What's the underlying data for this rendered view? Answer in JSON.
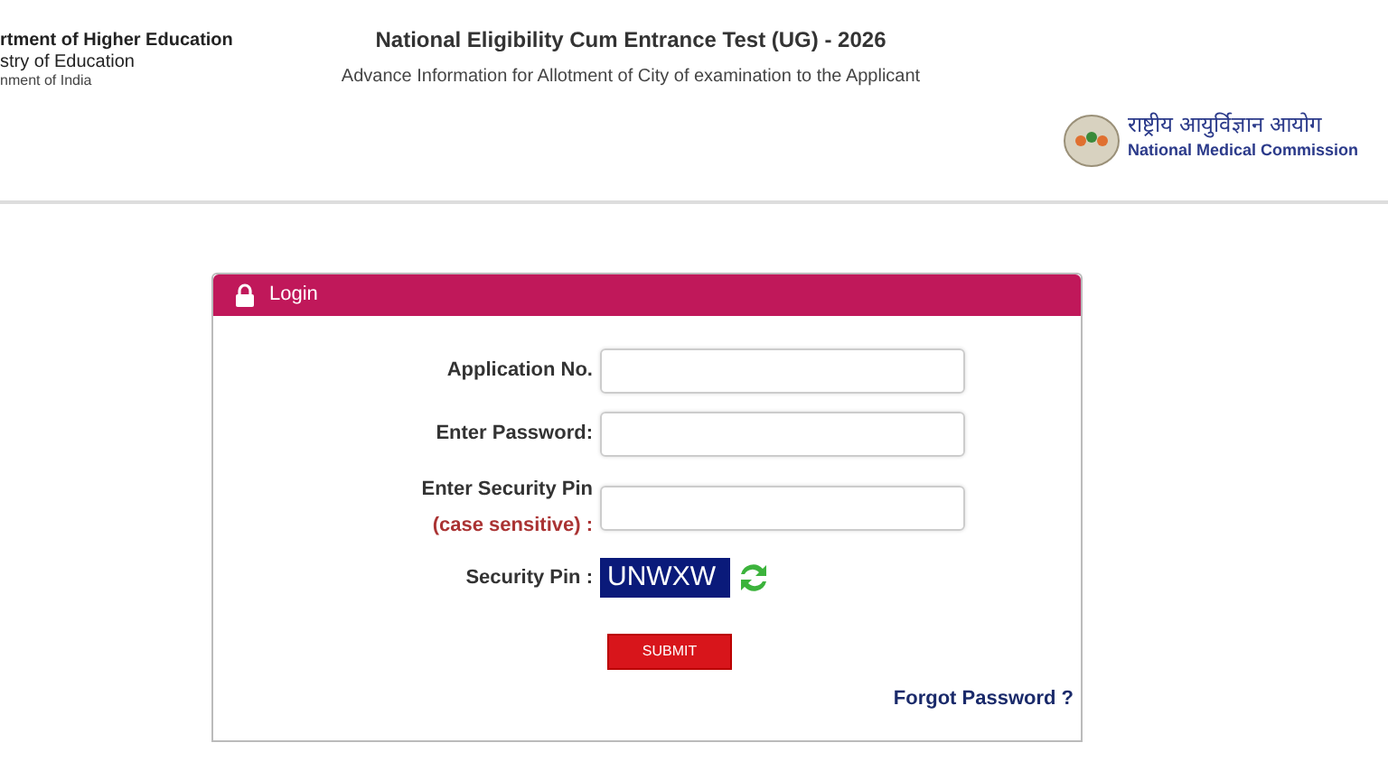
{
  "header": {
    "ministry_lines": [
      "rtment of Higher Education",
      "stry of Education",
      "nment of India"
    ],
    "title": "National Eligibility Cum Entrance Test (UG) - 2026",
    "subtitle": "Advance Information for Allotment of City of examination to the Applicant",
    "commission_hindi": "राष्ट्रीय आयुर्विज्ञान आयोग",
    "commission": "National Medical Commission"
  },
  "login": {
    "title": "Login",
    "fields": [
      {
        "label": "Application No."
      },
      {
        "label": "Enter Password:"
      },
      {
        "label": "Enter Security Pin",
        "note": "(case sensitive) :"
      }
    ],
    "security_pin_label": "Security Pin :",
    "captcha": "UNWXW",
    "submit": "SUBMIT",
    "forgot": "Forgot Password ?"
  }
}
